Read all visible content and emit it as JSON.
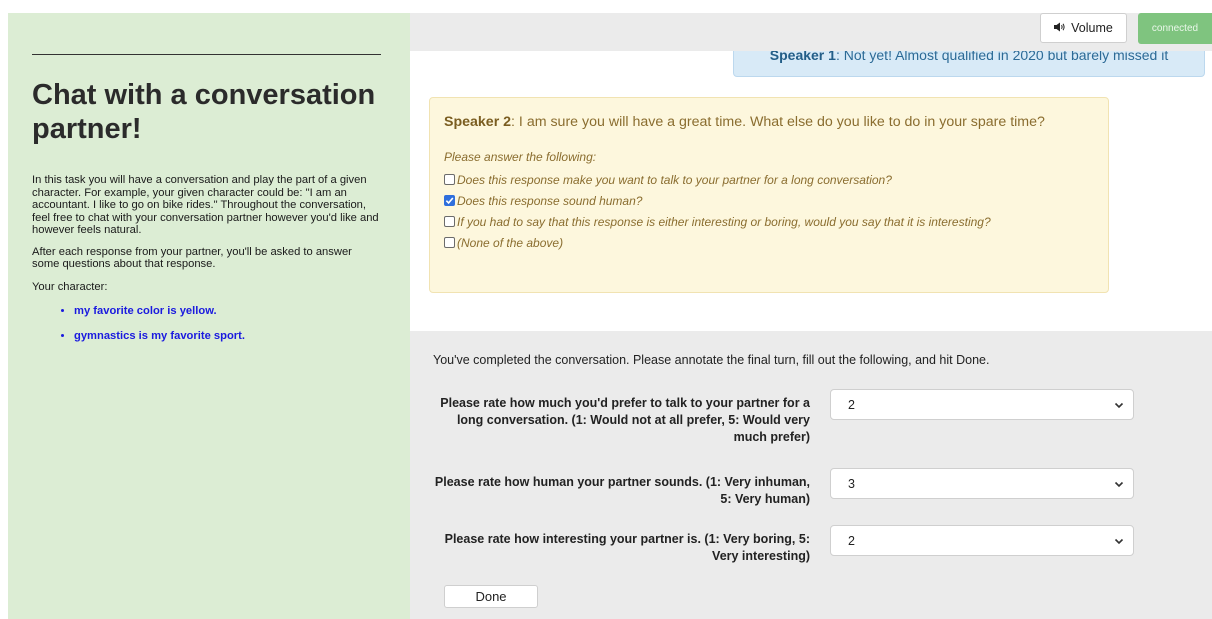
{
  "sidebar": {
    "title": "Chat with a conversation partner!",
    "intro": "In this task you will have a conversation and play the part of a given character. For example, your given character could be: \"I am an accountant. I like to go on bike rides.\" Throughout the conversation, feel free to chat with your conversation partner however you'd like and however feels natural.",
    "after": "After each response from your partner, you'll be asked to answer some questions about that response.",
    "character_label": "Your character:",
    "traits": [
      "my favorite color is yellow.",
      "gymnastics is my favorite sport."
    ]
  },
  "topbar": {
    "volume_label": "Volume",
    "volume_icon": "speaker-icon",
    "status": "connected"
  },
  "messages": [
    {
      "speaker": "Speaker 1",
      "text": ": Not yet! Almost qualified in 2020 but barely missed it"
    },
    {
      "speaker": "Speaker 2",
      "text": ": I am sure you will have a great time. What else do you like to do in your spare time?"
    }
  ],
  "annotation": {
    "prompt": "Please answer the following:",
    "options": [
      {
        "label": "Does this response make you want to talk to your partner for a long conversation?",
        "checked": false
      },
      {
        "label": "Does this response sound human?",
        "checked": true
      },
      {
        "label": "If you had to say that this response is either interesting or boring, would you say that it is interesting?",
        "checked": false
      },
      {
        "label": "(None of the above)",
        "checked": false
      }
    ]
  },
  "final": {
    "message": "You've completed the conversation. Please annotate the final turn, fill out the following, and hit Done.",
    "questions": [
      {
        "label": "Please rate how much you'd prefer to talk to your partner for a long conversation. (1: Would not at all prefer, 5: Would very much prefer)",
        "value": "2"
      },
      {
        "label": "Please rate how human your partner sounds. (1: Very inhuman, 5: Very human)",
        "value": "3"
      },
      {
        "label": "Please rate how interesting your partner is. (1: Very boring, 5: Very interesting)",
        "value": "2"
      }
    ],
    "done_label": "Done"
  },
  "colors": {
    "sidebar_bg": "#dcedd4",
    "link": "#1a1adf",
    "connected": "#7fc47f",
    "speaker1_bg": "#d8eaf7",
    "speaker2_bg": "#fdf7dd"
  }
}
